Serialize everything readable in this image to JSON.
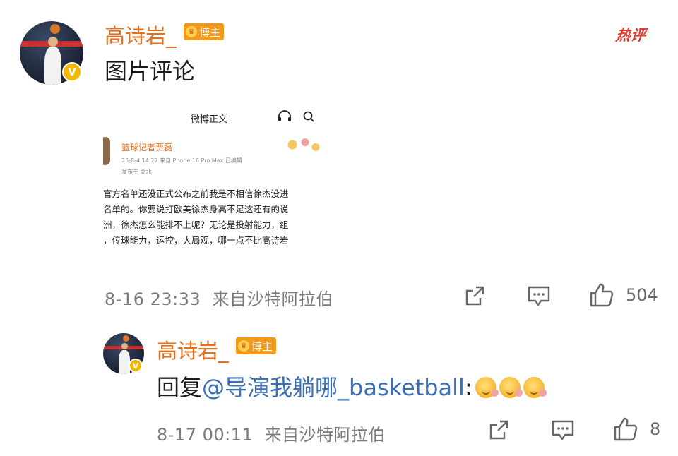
{
  "main_comment": {
    "username": "高诗岩_",
    "badge": "博主",
    "text": "图片评论",
    "hot_label": "热评",
    "timestamp": "8-16 23:33",
    "location": "来自沙特阿拉伯",
    "like_count": "504",
    "embedded_image": {
      "header_title": "微博正文",
      "author": "篮球记者贾磊",
      "meta": "25-8-4 14:27  来自iPhone 16 Pro Max  已编辑",
      "meta2": "发布于 湖北",
      "lines": [
        "官方名单还没正式公布之前我是不相信徐杰没进",
        "名单的。你要说打欧美徐杰身高不足这还有的说",
        "洲，徐杰怎么能排不上呢？无论是投射能力，组",
        "，传球能力，运控，大局观，哪一点不比高诗岩"
      ]
    }
  },
  "reply": {
    "username": "高诗岩_",
    "badge": "博主",
    "prefix": "回复",
    "mention": "@导演我躺哪_basketball",
    "suffix": ":",
    "emoji_count": 3,
    "timestamp": "8-17 00:11",
    "location": "来自沙特阿拉伯",
    "like_count": "8"
  },
  "colors": {
    "username": "#e86f1a",
    "badge": "#f39a1d",
    "hot": "#e03a31",
    "mention": "#3b6fb6",
    "meta": "#7a7a7a"
  },
  "icons": [
    "verified-icon",
    "share-icon",
    "comment-icon",
    "like-icon",
    "headphones-icon",
    "search-icon",
    "crown-icon"
  ]
}
